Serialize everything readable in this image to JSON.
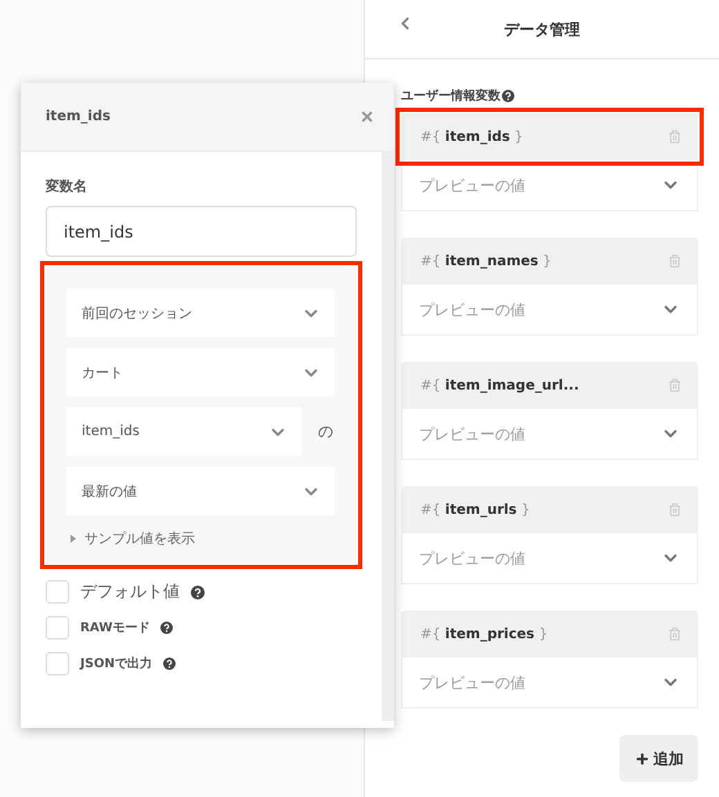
{
  "panel": {
    "title": "データ管理",
    "section_label": "ユーザー情報変数",
    "variables": [
      {
        "label": "#{ **item_ids** }",
        "preview": "プレビューの値",
        "highlighted": true
      },
      {
        "label": "#{ **item_names** }",
        "preview": "プレビューの値",
        "highlighted": false
      },
      {
        "label": "#{ **item_image_url...**",
        "preview": "プレビューの値",
        "highlighted": false
      },
      {
        "label": "#{ **item_urls** }",
        "preview": "プレビューの値",
        "highlighted": false
      },
      {
        "label": "#{ **item_prices** }",
        "preview": "プレビューの値",
        "highlighted": false
      }
    ],
    "add_button": "追加"
  },
  "dialog": {
    "title": "item_ids",
    "name_label": "変数名",
    "name_value": "item_ids",
    "source": {
      "highlighted": true,
      "selects": [
        {
          "value": "前回のセッション"
        },
        {
          "value": "カート"
        },
        {
          "value": "item_ids",
          "suffix": "の"
        },
        {
          "value": "最新の値"
        }
      ],
      "sample_toggle": {
        "label": "サンプル値を表示",
        "expanded": false
      }
    },
    "options": [
      {
        "label": "デフォルト値",
        "checked": false,
        "bold": false
      },
      {
        "label": "RAWモード",
        "checked": false,
        "bold": true
      },
      {
        "label": "JSONで出力",
        "checked": false,
        "bold": true
      }
    ]
  }
}
